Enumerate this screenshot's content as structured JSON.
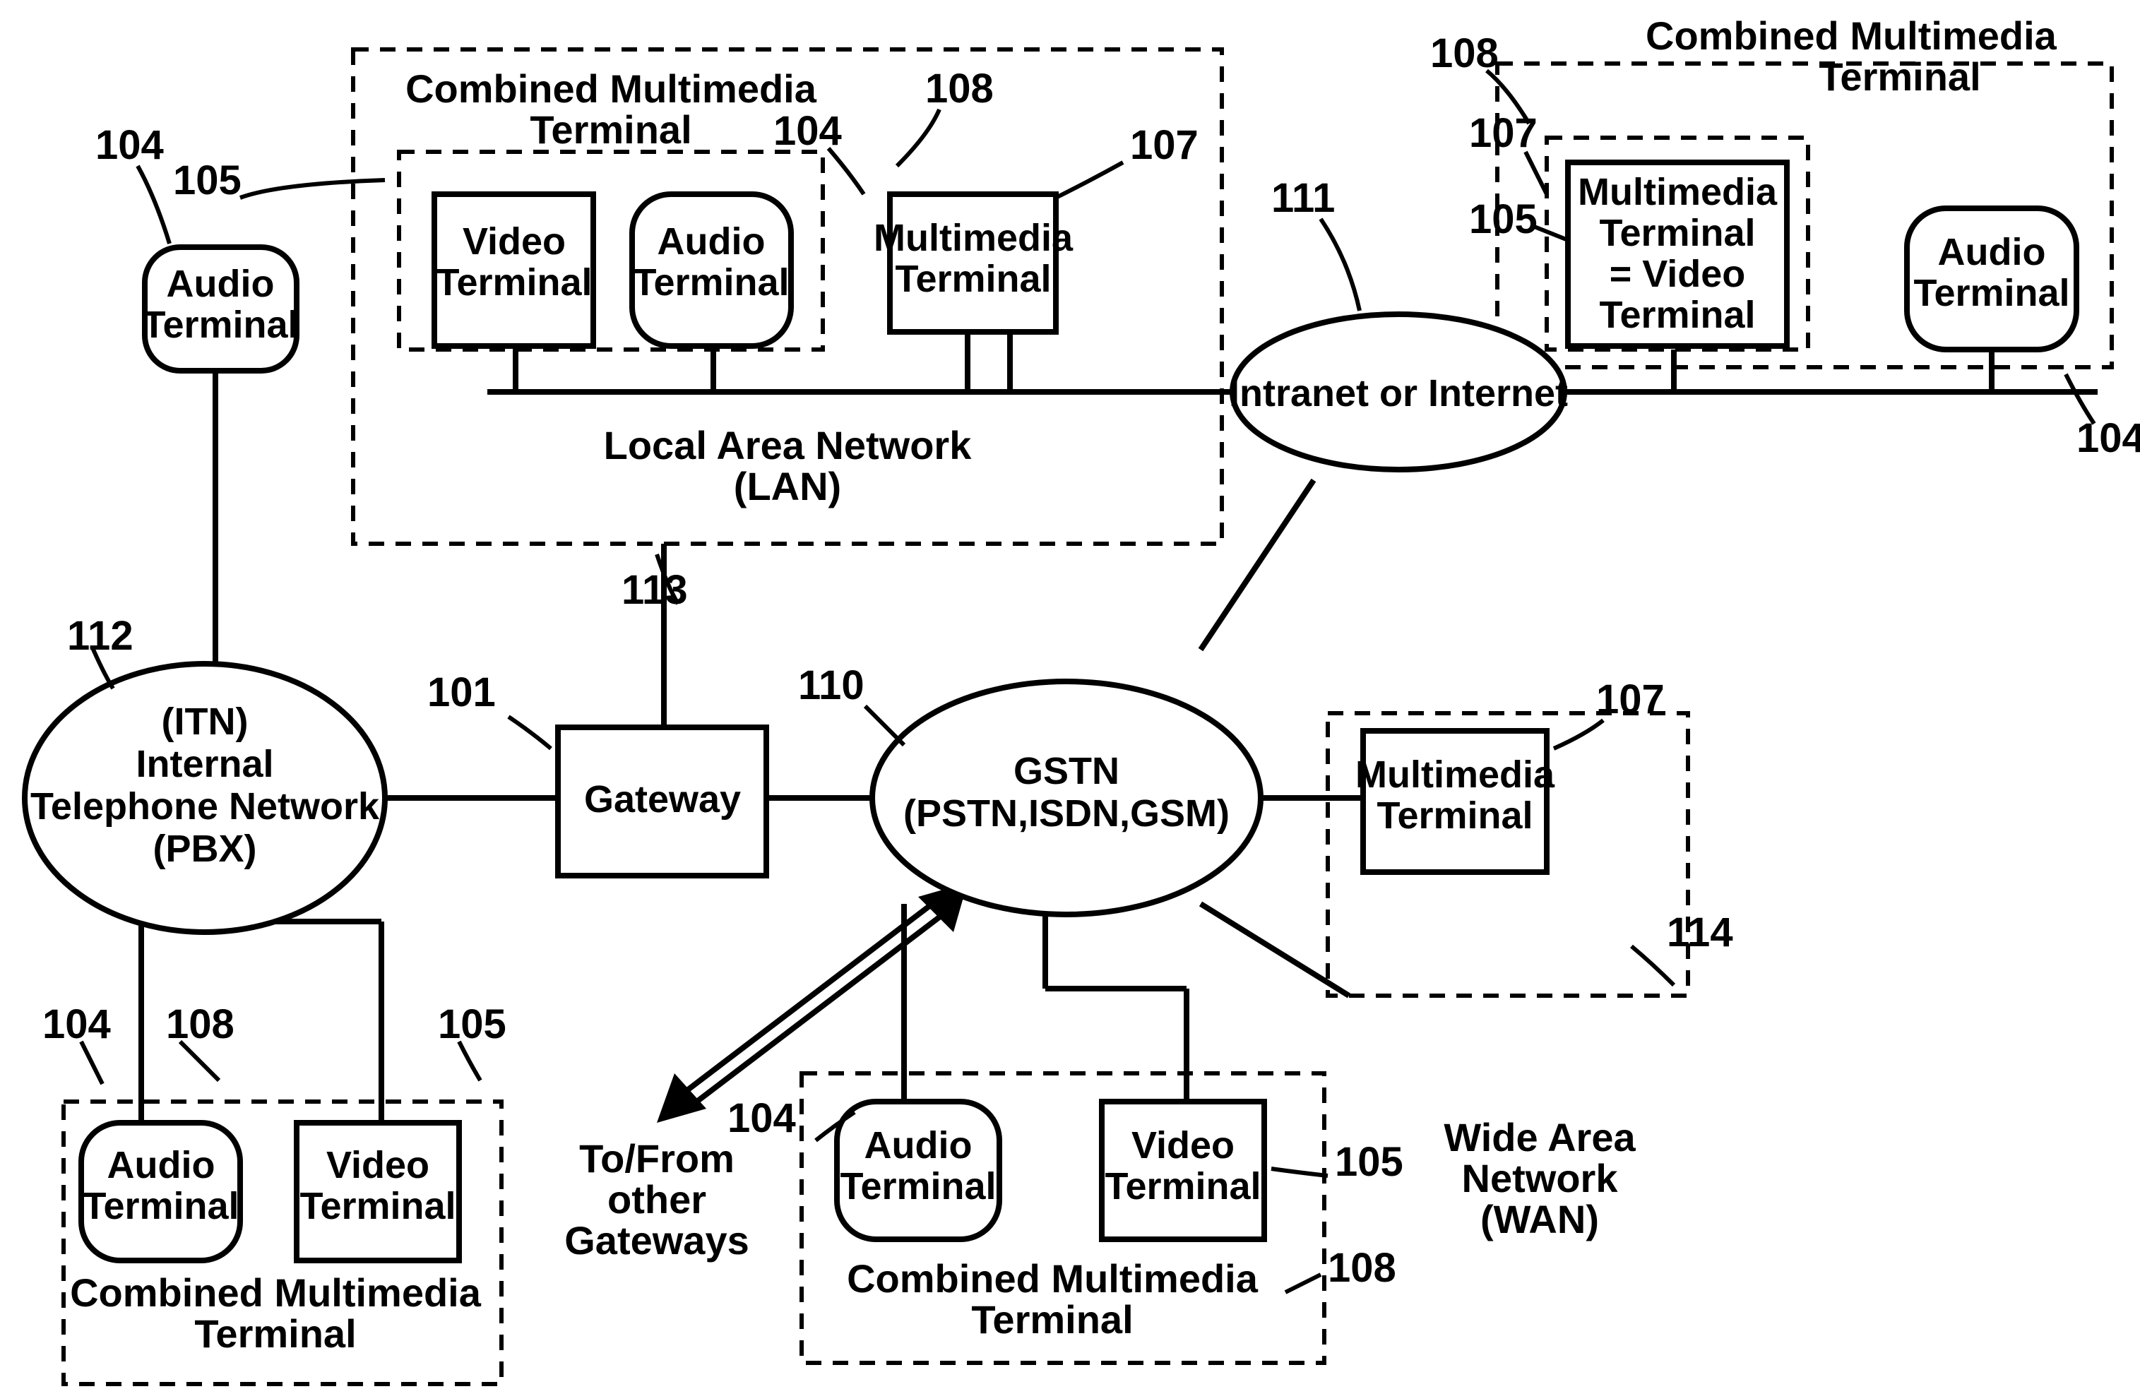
{
  "nodes": {
    "audio_tl": "Audio\nTerminal",
    "video_lan": "Video\nTerminal",
    "audio_lan": "Audio\nTerminal",
    "multimedia_lan": "Multimedia\nTerminal",
    "lan_label": "Local Area Network\n(LAN)",
    "cmt_lan": "Combined Multimedia\nTerminal",
    "intranet": "Intranet or Internet",
    "video_eq": "Multimedia\nTerminal\n= Video\nTerminal",
    "audio_tr": "Audio\nTerminal",
    "cmt_tr": "Combined Multimedia\nTerminal",
    "itn": "(ITN)\nInternal\nTelephone Network\n(PBX)",
    "gateway": "Gateway",
    "gstn": "GSTN\n(PSTN,ISDN,GSM)",
    "multimedia_wan": "Multimedia\nTerminal",
    "audio_bl": "Audio\nTerminal",
    "video_bl": "Video\nTerminal",
    "cmt_bl": "Combined Multimedia\nTerminal",
    "to_from": "To/From\nother\nGateways",
    "audio_bc": "Audio\nTerminal",
    "video_bc": "Video\nTerminal",
    "cmt_bc": "Combined Multimedia\nTerminal",
    "wan_label": "Wide Area\nNetwork\n(WAN)"
  },
  "refs": {
    "r101": "101",
    "r104": "104",
    "r105": "105",
    "r107": "107",
    "r108": "108",
    "r110": "110",
    "r111": "111",
    "r112": "112",
    "r113": "113",
    "r114": "114"
  }
}
